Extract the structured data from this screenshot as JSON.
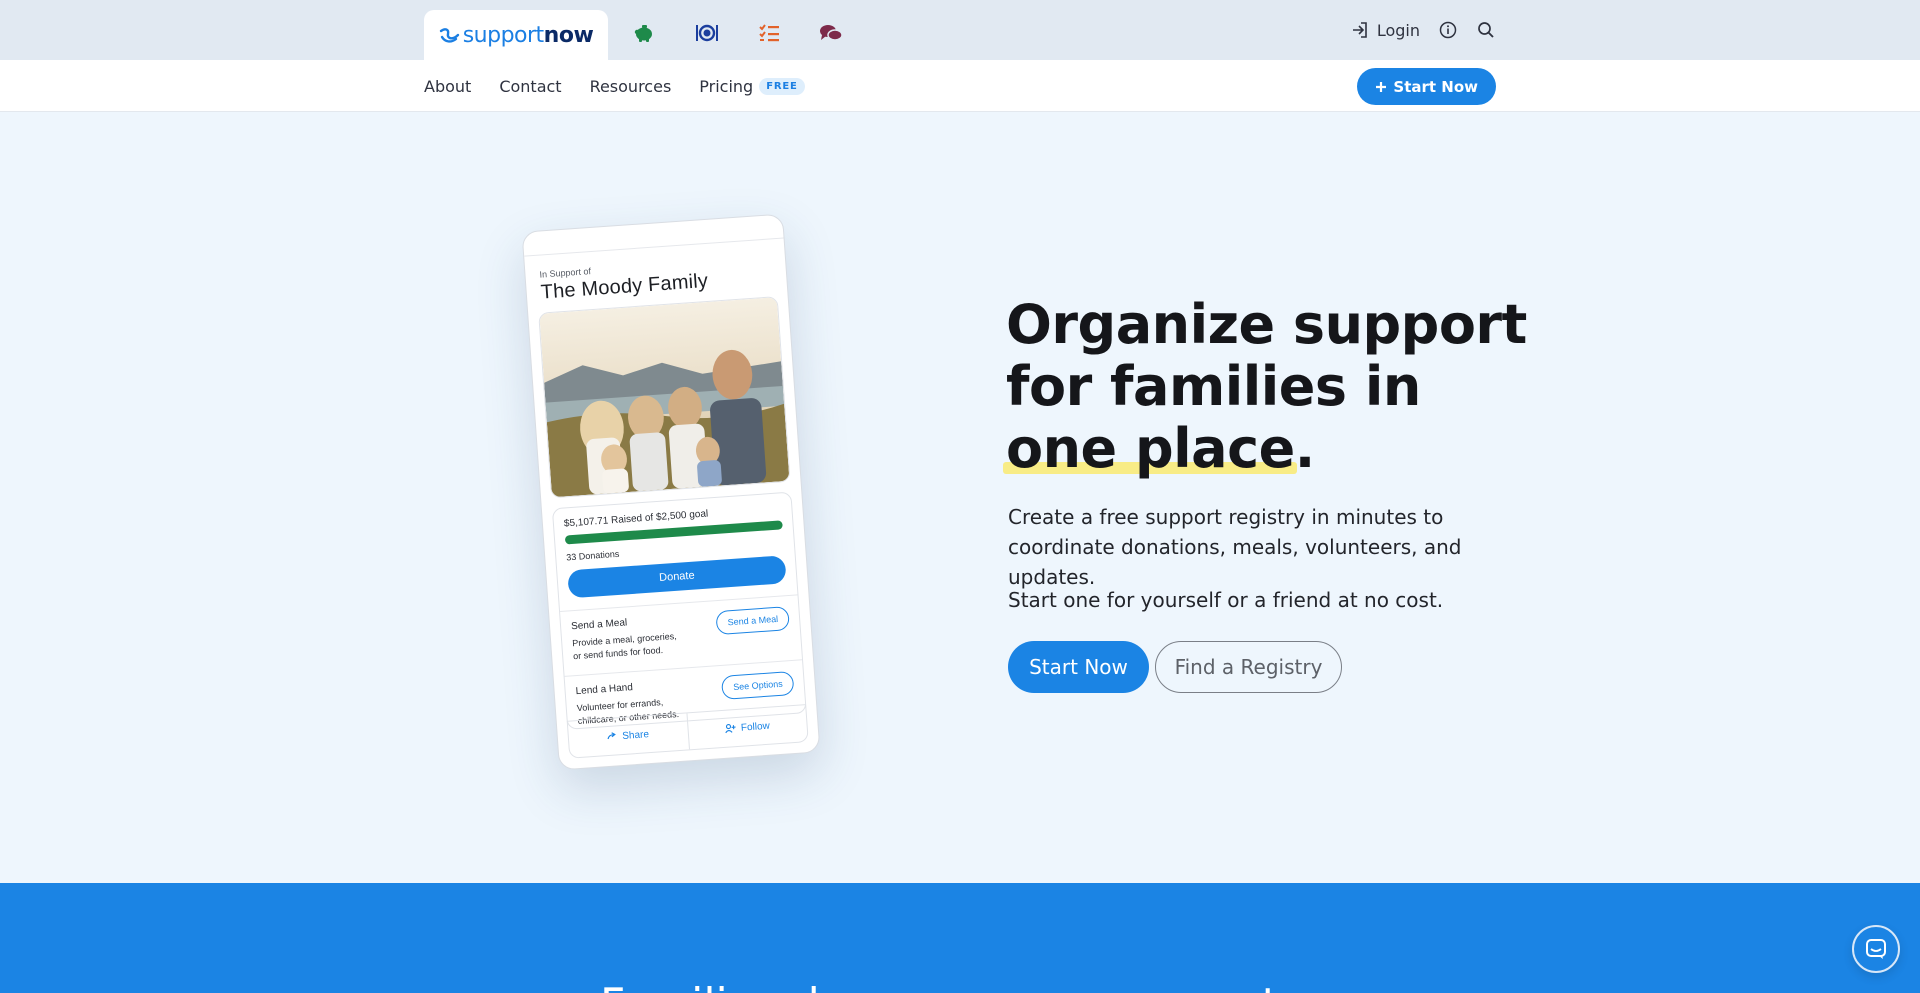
{
  "brand": {
    "logo_light": "support",
    "logo_bold": "now"
  },
  "topbar": {
    "category_icons": [
      "piggy-bank-icon",
      "meal-icon",
      "task-list-icon",
      "chat-icon"
    ],
    "login_label": "Login"
  },
  "nav": {
    "items": [
      "About",
      "Contact",
      "Resources",
      "Pricing"
    ],
    "pricing_badge": "FREE",
    "cta_label": "Start Now"
  },
  "phone": {
    "eyebrow": "In Support of",
    "title": "The Moody Family",
    "raised_text": "$5,107.71 Raised of $2,500 goal",
    "donations": "33 Donations",
    "donate_label": "Donate",
    "meal": {
      "title": "Send a Meal",
      "desc_1": "Provide a meal, groceries,",
      "desc_2": "or send funds for food.",
      "button": "Send a Meal"
    },
    "hand": {
      "title": "Lend a Hand",
      "desc_1": "Volunteer for errands,",
      "desc_2": "childcare, or other needs.",
      "button": "See Options"
    },
    "share_label": "Share",
    "follow_label": "Follow"
  },
  "hero": {
    "title_line1": "Organize support",
    "title_line2": "for families in",
    "title_highlight": "one place",
    "title_end": ".",
    "description": "Create a free support registry in minutes to coordinate donations, meals, volunteers, and updates.",
    "subtext": "Start one for yourself or a friend at no cost.",
    "primary_cta": "Start Now",
    "secondary_cta": "Find a Registry"
  },
  "band": {
    "heading": "Families deserve more support"
  },
  "colors": {
    "brand_blue": "#1b84e4",
    "navy": "#0b2a66",
    "success_green": "#1e8a4a",
    "highlight_yellow": "#f8ec86"
  }
}
